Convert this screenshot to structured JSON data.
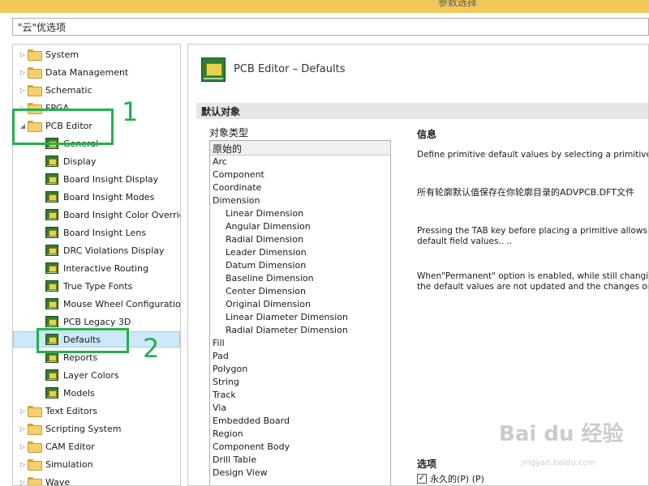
{
  "window_title": "参数选择",
  "search_value": "\"云\"优选项",
  "tree": {
    "top_items": [
      "System",
      "Data Management",
      "Schematic",
      "FPGA"
    ],
    "pcb_editor": "PCB Editor",
    "pcb_children": [
      "General",
      "Display",
      "Board Insight Display",
      "Board Insight Modes",
      "Board Insight Color Overrid",
      "Board Insight Lens",
      "DRC Violations Display",
      "Interactive Routing",
      "True Type Fonts",
      "Mouse Wheel Configuration",
      "PCB Legacy 3D",
      "Defaults",
      "Reports",
      "Layer Colors",
      "Models"
    ],
    "bottom_items": [
      "Text Editors",
      "Scripting System",
      "CAM Editor",
      "Simulation",
      "Wave"
    ]
  },
  "header": {
    "title": "PCB Editor – Defaults"
  },
  "section_title": "默认对象",
  "object_type_label": "对象类型",
  "object_list": {
    "header": "原始的",
    "items": [
      {
        "label": "Arc",
        "indent": 0
      },
      {
        "label": "Component",
        "indent": 0
      },
      {
        "label": "Coordinate",
        "indent": 0
      },
      {
        "label": "Dimension",
        "indent": 0
      },
      {
        "label": "Linear Dimension",
        "indent": 1
      },
      {
        "label": "Angular Dimension",
        "indent": 1
      },
      {
        "label": "Radial Dimension",
        "indent": 1
      },
      {
        "label": "Leader Dimension",
        "indent": 1
      },
      {
        "label": "Datum Dimension",
        "indent": 1
      },
      {
        "label": "Baseline Dimension",
        "indent": 1
      },
      {
        "label": "Center Dimension",
        "indent": 1
      },
      {
        "label": "Original Dimension",
        "indent": 1
      },
      {
        "label": "Linear Diameter Dimension",
        "indent": 1
      },
      {
        "label": "Radial Diameter Dimension",
        "indent": 1
      },
      {
        "label": "Fill",
        "indent": 0
      },
      {
        "label": "Pad",
        "indent": 0
      },
      {
        "label": "Polygon",
        "indent": 0
      },
      {
        "label": "String",
        "indent": 0
      },
      {
        "label": "Track",
        "indent": 0
      },
      {
        "label": "Via",
        "indent": 0
      },
      {
        "label": "Embedded Board",
        "indent": 0
      },
      {
        "label": "Region",
        "indent": 0
      },
      {
        "label": "Component Body",
        "indent": 0
      },
      {
        "label": "Drill Table",
        "indent": 0
      },
      {
        "label": "Design View",
        "indent": 0
      }
    ]
  },
  "info": {
    "title": "信息",
    "p1": "Define primitive default values by selecting a primitive ar",
    "p2": "所有轮廓默认值保存在你轮廓目录的ADVPCB.DFT文件",
    "p3a": "Pressing the TAB key before placing a primitive allows yo",
    "p3b": "default field values.. ..",
    "p4a": "When\"Permanent\" option is enabled, while still changin",
    "p4b": "the default values are not updated and the changes onl"
  },
  "options": {
    "title": "选项",
    "permanent_label": "永久的(P) (P)",
    "permanent_checked": true
  },
  "callouts": {
    "one": "1",
    "two": "2"
  },
  "watermark": {
    "main": "Bai du 经验",
    "sub": "jingyan.baidu.com"
  }
}
